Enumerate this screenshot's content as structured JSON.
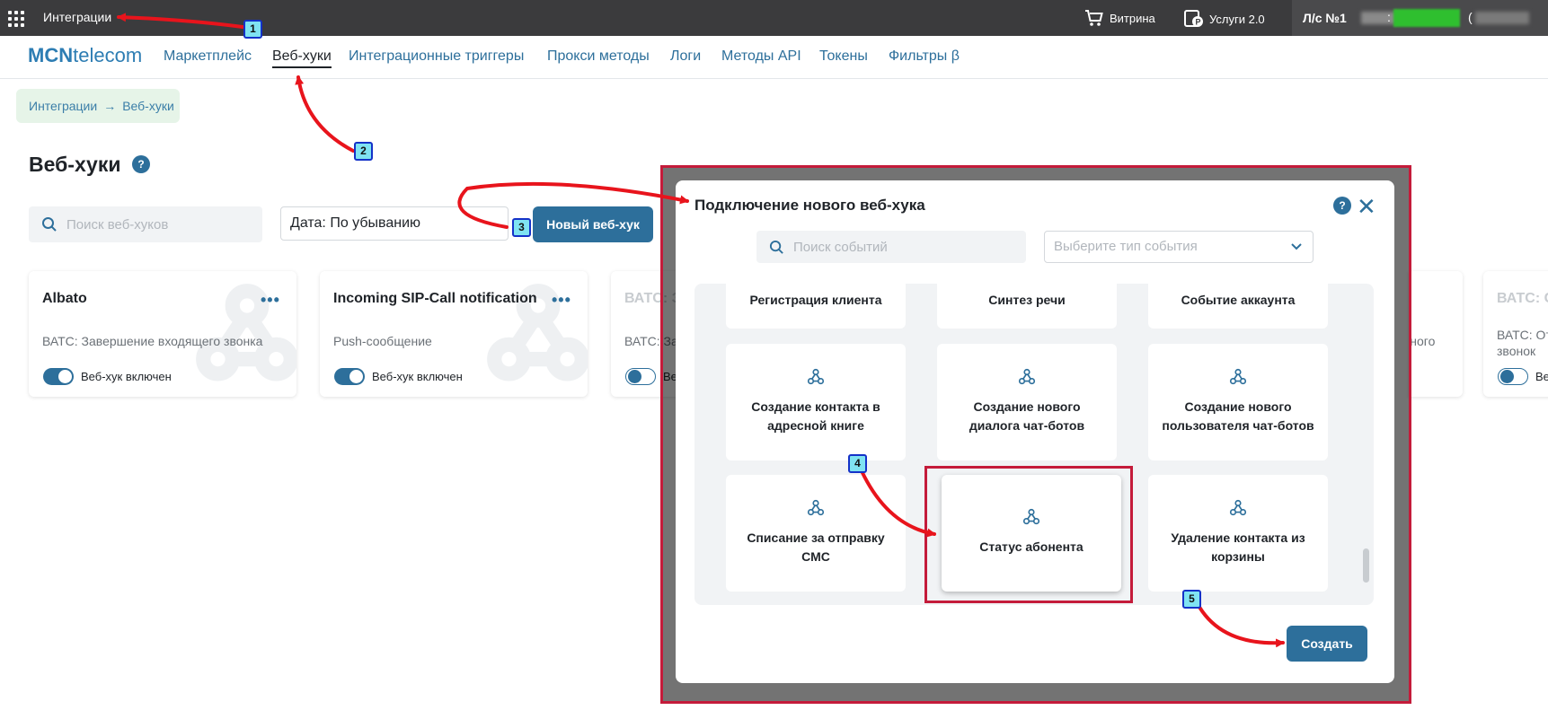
{
  "topbar": {
    "title": "Интеграции",
    "showcase_label": "Витрина",
    "services_label": "Услуги 2.0",
    "account_label": "Л/с №1",
    "account_colon": ":",
    "account_paren": "("
  },
  "navbar": {
    "logo_bold": "MCN",
    "logo_rest": "telecom",
    "items": [
      {
        "label": "Маркетплейс"
      },
      {
        "label": "Веб-хуки"
      },
      {
        "label": "Интеграционные триггеры"
      },
      {
        "label": "Прокси методы"
      },
      {
        "label": "Логи"
      },
      {
        "label": "Методы API"
      },
      {
        "label": "Токены"
      },
      {
        "label": "Фильтры β"
      }
    ]
  },
  "breadcrumb": {
    "root": "Интеграции",
    "sep": "→",
    "current": "Веб-хуки"
  },
  "page": {
    "title": "Веб-хуки",
    "help": "?",
    "search_placeholder": "Поиск веб-хуков",
    "sort_label": "Дата: По убыванию",
    "new_button": "Новый веб-хук"
  },
  "cards": [
    {
      "title": "Albato",
      "subtitle": "ВАТС: Завершение входящего звонка",
      "toggle_label": "Веб-хук включен",
      "enabled": true
    },
    {
      "title": "Incoming SIP-Call notification",
      "subtitle": "Push-сообщение",
      "toggle_label": "Веб-хук включен",
      "enabled": true
    },
    {
      "title": "ВАТС: З",
      "subtitle": "ВАТС: За",
      "toggle_label": "Ве",
      "enabled": false
    },
    {
      "title": "ВАТС: С",
      "subtitle": "ВАТС: От звонок",
      "toggle_label": "Ве",
      "enabled": false
    }
  ],
  "partial_card": {
    "dots": "•••",
    "text": "чного"
  },
  "modal": {
    "title": "Подключение нового веб-хука",
    "help": "?",
    "close": "✕",
    "search_placeholder": "Поиск событий",
    "type_placeholder": "Выберите тип события",
    "tiles_top": [
      "Регистрация клиента",
      "Синтез речи",
      "Событие аккаунта"
    ],
    "tiles_mid": [
      "Создание контакта в адресной книге",
      "Создание нового диалога чат-ботов",
      "Создание нового пользователя чат-ботов"
    ],
    "tiles_bottom": [
      "Списание за отправку СМС",
      "Статус абонента",
      "Удаление контакта из корзины"
    ],
    "create_button": "Создать"
  },
  "annotations": [
    "1",
    "2",
    "3",
    "4",
    "5"
  ],
  "colors": {
    "accent": "#2d6f9b",
    "highlight": "#c41b3a",
    "arrow": "#e8141c",
    "badge_fill": "#7fe3f2",
    "badge_border": "#1432c8"
  }
}
